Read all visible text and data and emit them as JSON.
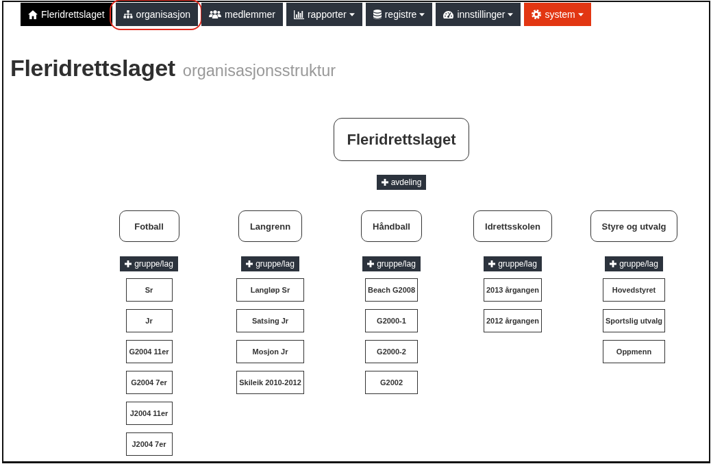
{
  "nav": {
    "items": [
      {
        "label": "Fleridrettslaget",
        "selected": true,
        "dropdown": false,
        "kind": "default",
        "circled": false
      },
      {
        "label": "organisasjon",
        "selected": false,
        "dropdown": false,
        "kind": "default",
        "circled": true
      },
      {
        "label": "medlemmer",
        "selected": false,
        "dropdown": false,
        "kind": "default",
        "circled": false
      },
      {
        "label": "rapporter",
        "selected": false,
        "dropdown": true,
        "kind": "default",
        "circled": false
      },
      {
        "label": "registre",
        "selected": false,
        "dropdown": true,
        "kind": "default",
        "circled": false
      },
      {
        "label": "innstillinger",
        "selected": false,
        "dropdown": true,
        "kind": "default",
        "circled": false
      },
      {
        "label": "system",
        "selected": false,
        "dropdown": true,
        "kind": "danger",
        "circled": false
      }
    ]
  },
  "heading": {
    "title": "Fleridrettslaget",
    "subtitle": "organisasjonsstruktur"
  },
  "org_chart": {
    "root": {
      "label": "Fleridrettslaget"
    },
    "add_department_button": "avdeling",
    "departments": [
      {
        "label": "Fotball",
        "add_button": "gruppe/lag",
        "children": [
          {
            "label": "Sr"
          },
          {
            "label": "Jr"
          },
          {
            "label": "G2004 11er"
          },
          {
            "label": "G2004 7er"
          },
          {
            "label": "J2004 11er"
          },
          {
            "label": "J2004 7er"
          }
        ]
      },
      {
        "label": "Langrenn",
        "add_button": "gruppe/lag",
        "children": [
          {
            "label": "Langløp Sr"
          },
          {
            "label": "Satsing Jr"
          },
          {
            "label": "Mosjon Jr"
          },
          {
            "label": "Skileik 2010-2012"
          }
        ]
      },
      {
        "label": "Håndball",
        "add_button": "gruppe/lag",
        "children": [
          {
            "label": "Beach G2008"
          },
          {
            "label": "G2000-1"
          },
          {
            "label": "G2000-2"
          },
          {
            "label": "G2002"
          }
        ]
      },
      {
        "label": "Idrettsskolen",
        "add_button": "gruppe/lag",
        "children": [
          {
            "label": "2013 årgangen"
          },
          {
            "label": "2012 årgangen"
          }
        ]
      },
      {
        "label": "Styre og utvalg",
        "add_button": "gruppe/lag",
        "children": [
          {
            "label": "Hovedstyret"
          },
          {
            "label": "Sportslig utvalg"
          },
          {
            "label": "Oppmenn"
          }
        ]
      }
    ]
  }
}
